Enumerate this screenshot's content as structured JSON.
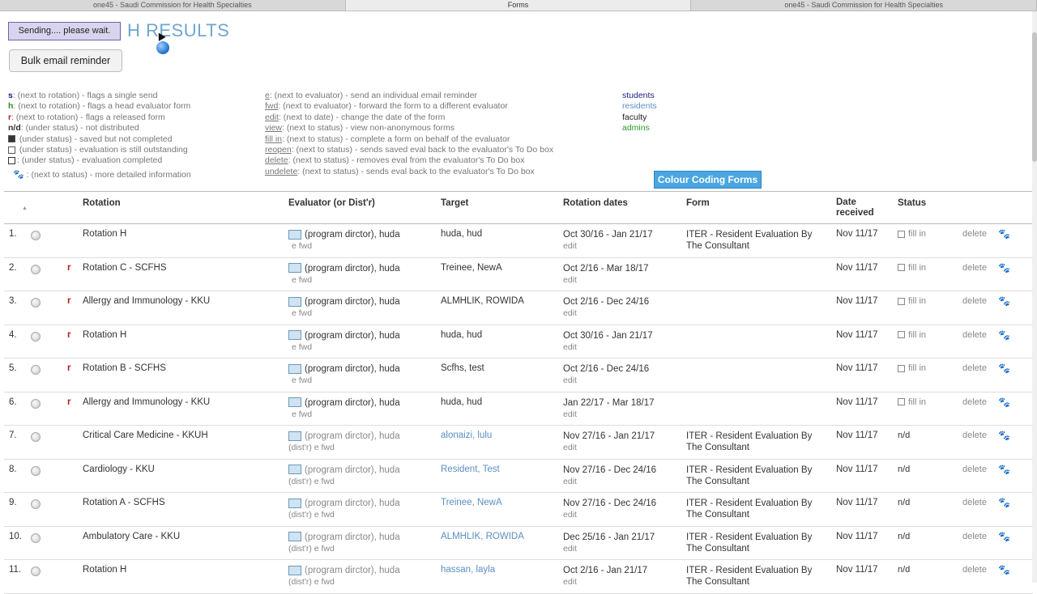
{
  "browser_tabs": [
    {
      "label": "one45 - Saudi Commission for Health Specialties",
      "active": false
    },
    {
      "label": "Forms",
      "active": true
    },
    {
      "label": "one45 - Saudi Commission for Health Specialties",
      "active": false
    }
  ],
  "page": {
    "title": "H RESULTS",
    "sending_message": "Sending.... please wait.",
    "bulk_email_label": "Bulk email reminder",
    "colour_coding_label": "Colour Coding Forms"
  },
  "legend_col1": [
    {
      "key": "s",
      "text": ": (next to rotation) - flags a single send"
    },
    {
      "key": "h",
      "text": ": (next to rotation) - flags a head evaluator form"
    },
    {
      "key": "r",
      "text": ": (next to rotation) - flags a released form"
    },
    {
      "key": "n/d",
      "text": ": (under status) - not distributed"
    },
    {
      "key": "",
      "text": " (under status) - saved but not completed"
    },
    {
      "key": "",
      "text": " (under status) - evaluation is still outstanding"
    },
    {
      "key": "",
      "text": ": (under status) - evaluation completed"
    },
    {
      "key": "",
      "text": " : (next to status) - more detailed information"
    }
  ],
  "legend_col2": [
    {
      "key": "e",
      "text": ": (next to evaluator) - send an individual email reminder"
    },
    {
      "key": "fwd",
      "text": ": (next to evaluator) - forward the form to a different evaluator"
    },
    {
      "key": "edit",
      "text": ": (next to date) - change the date of the form"
    },
    {
      "key": "view",
      "text": ": (next to status) - view non-anonymous forms"
    },
    {
      "key": "fill in",
      "text": ": (next to status) - complete a form on behalf of the evaluator"
    },
    {
      "key": "reopen",
      "text": ": (next to status) - sends saved eval back to the evaluator's To Do box"
    },
    {
      "key": "delete",
      "text": ": (next to status) - removes eval from the evaluator's To Do box"
    },
    {
      "key": "undelete",
      "text": ": (next to status) - sends eval back to the evaluator's To Do box"
    }
  ],
  "roles": [
    {
      "label": "students",
      "color": "#1a1a8c"
    },
    {
      "label": "residents",
      "color": "#5a8fc2"
    },
    {
      "label": "faculty",
      "color": "#222222"
    },
    {
      "label": "admins",
      "color": "#2a9a2a"
    }
  ],
  "table": {
    "headers": {
      "rotation": "Rotation",
      "evaluator": "Evaluator (or Dist'r)",
      "target": "Target",
      "rotation_dates": "Rotation dates",
      "form": "Form",
      "date_received": "Date received",
      "status": "Status"
    },
    "rows": [
      {
        "num": "1.",
        "flag": "",
        "rotation": "Rotation H",
        "evaluator": "(program dirctor), huda",
        "eval_sub": "e fwd",
        "target": "huda, hud",
        "dates": "Oct 30/16 - Jan 21/17",
        "edit": "edit",
        "form1": "ITER - Resident Evaluation By",
        "form2": "The Consultant",
        "received": "Nov 11/17",
        "status": "fill in",
        "delete": "delete"
      },
      {
        "num": "2.",
        "flag": "r",
        "rotation": "Rotation C - SCFHS",
        "evaluator": "(program dirctor), huda",
        "eval_sub": "e fwd",
        "target": "Treinee, NewA",
        "dates": "Oct 2/16 - Mar 18/17",
        "edit": "edit",
        "form1": "",
        "form2": "",
        "received": "Nov 11/17",
        "status": "fill in",
        "delete": "delete"
      },
      {
        "num": "3.",
        "flag": "r",
        "rotation": "Allergy and Immunology - KKU",
        "evaluator": "(program dirctor), huda",
        "eval_sub": "e fwd",
        "target": "ALMHLIK, ROWIDA",
        "dates": "Oct 2/16 - Dec 24/16",
        "edit": "edit",
        "form1": "",
        "form2": "",
        "received": "Nov 11/17",
        "status": "fill in",
        "delete": "delete"
      },
      {
        "num": "4.",
        "flag": "r",
        "rotation": "Rotation H",
        "evaluator": "(program dirctor), huda",
        "eval_sub": "e fwd",
        "target": "huda, hud",
        "dates": "Oct 30/16 - Jan 21/17",
        "edit": "edit",
        "form1": "",
        "form2": "",
        "received": "Nov 11/17",
        "status": "fill in",
        "delete": "delete"
      },
      {
        "num": "5.",
        "flag": "r",
        "rotation": "Rotation B - SCFHS",
        "evaluator": "(program dirctor), huda",
        "eval_sub": "e fwd",
        "target": "Scfhs, test",
        "dates": "Oct 2/16 - Dec 24/16",
        "edit": "edit",
        "form1": "",
        "form2": "",
        "received": "Nov 11/17",
        "status": "fill in",
        "delete": "delete"
      },
      {
        "num": "6.",
        "flag": "r",
        "rotation": "Allergy and Immunology - KKU",
        "evaluator": "(program dirctor), huda",
        "eval_sub": "e fwd",
        "target": "huda, hud",
        "dates": "Jan 22/17 - Mar 18/17",
        "edit": "edit",
        "form1": "",
        "form2": "",
        "received": "Nov 11/17",
        "status": "fill in",
        "delete": "delete"
      },
      {
        "num": "7.",
        "flag": "",
        "rotation": "Critical Care Medicine - KKUH",
        "evaluator": "(program dirctor), huda",
        "eval_sub": "(dist'r)  e fwd",
        "target": "alonaizi, lulu",
        "dates": "Nov 27/16 - Jan 21/17",
        "edit": "edit",
        "form1": "ITER - Resident Evaluation By",
        "form2": "The Consultant",
        "received": "Nov 11/17",
        "status": "n/d",
        "delete": "delete"
      },
      {
        "num": "8.",
        "flag": "",
        "rotation": "Cardiology - KKU",
        "evaluator": "(program dirctor), huda",
        "eval_sub": "(dist'r)  e fwd",
        "target": "Resident, Test",
        "dates": "Nov 27/16 - Dec 24/16",
        "edit": "edit",
        "form1": "ITER - Resident Evaluation By",
        "form2": "The Consultant",
        "received": "Nov 11/17",
        "status": "n/d",
        "delete": "delete"
      },
      {
        "num": "9.",
        "flag": "",
        "rotation": "Rotation A - SCFHS",
        "evaluator": "(program dirctor), huda",
        "eval_sub": "(dist'r)  e fwd",
        "target": "Treinee, NewA",
        "dates": "Nov 27/16 - Dec 24/16",
        "edit": "edit",
        "form1": "ITER - Resident Evaluation By",
        "form2": "The Consultant",
        "received": "Nov 11/17",
        "status": "n/d",
        "delete": "delete"
      },
      {
        "num": "10.",
        "flag": "",
        "rotation": "Ambulatory Care - KKU",
        "evaluator": "(program dirctor), huda",
        "eval_sub": "(dist'r)  e fwd",
        "target": "ALMHLIK, ROWIDA",
        "dates": "Dec 25/16 - Jan 21/17",
        "edit": "edit",
        "form1": "ITER - Resident Evaluation By",
        "form2": "The Consultant",
        "received": "Nov 11/17",
        "status": "n/d",
        "delete": "delete"
      },
      {
        "num": "11.",
        "flag": "",
        "rotation": "Rotation H",
        "evaluator": "(program dirctor), huda",
        "eval_sub": "(dist'r)  e fwd",
        "target": "hassan, layla",
        "dates": "Oct 2/16 - Jan 21/17",
        "edit": "edit",
        "form1": "ITER - Resident Evaluation By",
        "form2": "The Consultant",
        "received": "Nov 11/17",
        "status": "n/d",
        "delete": "delete"
      }
    ]
  }
}
